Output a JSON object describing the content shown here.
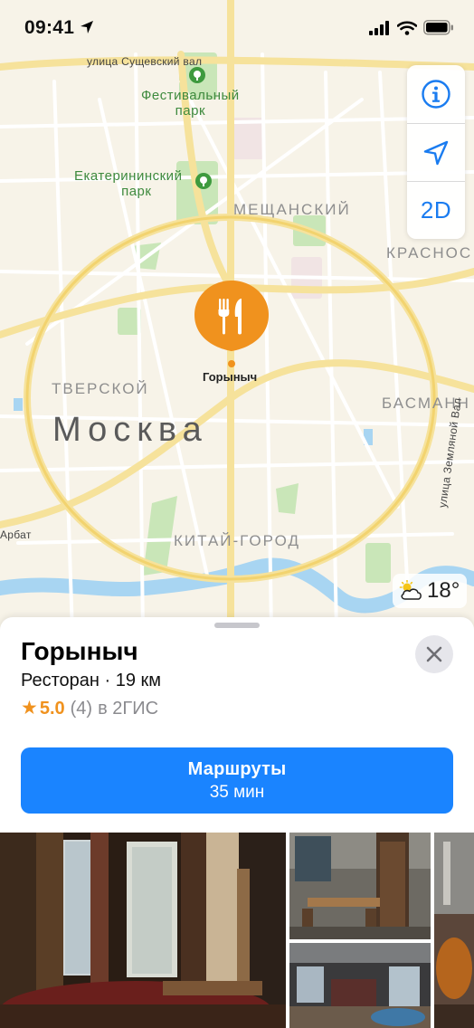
{
  "status_bar": {
    "time": "09:41"
  },
  "map": {
    "streets": [
      "улица Сущевский вал",
      "Арбат",
      "улица Земляной Вал"
    ],
    "parks": [
      {
        "line1": "Фестивальный",
        "line2": "парк"
      },
      {
        "line1": "Екатерининский",
        "line2": "парк"
      }
    ],
    "districts": [
      "МЕЩАНСКИЙ",
      "КРАСНОС",
      "ТВЕРСКОЙ",
      "БАСМАНН",
      "КИТАЙ-ГОРОД"
    ],
    "city": "Москва",
    "poi_label": "Горыныч",
    "controls": {
      "mode_label": "2D"
    },
    "weather": {
      "temperature": "18°"
    }
  },
  "place": {
    "name": "Горыныч",
    "subtitle": "Ресторан · 19 км",
    "rating_star": "★",
    "rating": "5.0",
    "reviews": "(4)",
    "source": "в 2ГИС",
    "route_label": "Маршруты",
    "route_time": "35 мин"
  },
  "colors": {
    "accent": "#1A84FF",
    "pin": "#F0921E",
    "park": "#3E8A3E"
  }
}
